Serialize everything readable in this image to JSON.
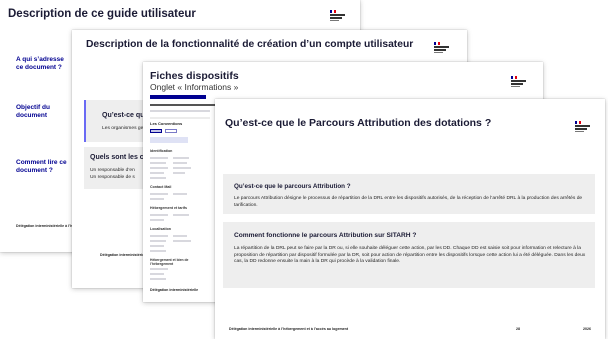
{
  "slide1": {
    "title": "Description de ce guide utilisateur",
    "sidebar": [
      "A qui s’adresse ce document ?",
      "Objectif du document",
      "Comment lire ce document ?"
    ],
    "footer": "Délégation interministérielle à l’hébergement et à l’accès au logement"
  },
  "slide2": {
    "title": "Description de la fonctionnalité de création d’un compte utilisateur",
    "section1": "Qu’est-ce que l",
    "section1_text": "Les organismes gest",
    "section2": "Quels sont les c",
    "section2_lines": [
      "Un responsable d’en",
      "Un responsable de s"
    ],
    "footer": "Délégation interministérielle à l’h"
  },
  "slide3": {
    "title": "Fiches dispositifs",
    "subtitle": "Onglet « Informations »",
    "mini_heading": "Les Conventions",
    "mini_sections": [
      "Identification",
      "Contact Mail",
      "Hébergement et tarifs",
      "Localisation",
      "Hébergement et bien de l’hébergement"
    ],
    "footer": "Délégation interministérielle"
  },
  "slide4": {
    "title": "Qu’est-ce que le Parcours Attribution des dotations ?",
    "box1": {
      "title": "Qu’est-ce que le parcours Attribution ?",
      "text": "Le parcours Attribution désigne le processus de répartition de la DRL entre les dispositifs autorisés, de la réception de l’arrêté DRL à la production des arrêtés de tarification."
    },
    "box2": {
      "title": "Comment fonctionne le parcours Attribution sur SITARH ?",
      "text": "La répartition de la DRL peut se faire par la DR ou, si elle souhaite déléguer cette action, par les DD. Chaque DD est saisie soit pour information et relecture à la proposition de répartition par dispositif formulée par la DR, soit pour action de répartition entre les dispositifs lorsque cette action lui a été déléguée. Dans les deux cas, la DD redonne ensuite la main à la DR qui procède à la validation finale."
    },
    "footer": "Délégation interministérielle à l’hébergement et à l’accès au logement",
    "page_number": "28",
    "year": "2026"
  }
}
